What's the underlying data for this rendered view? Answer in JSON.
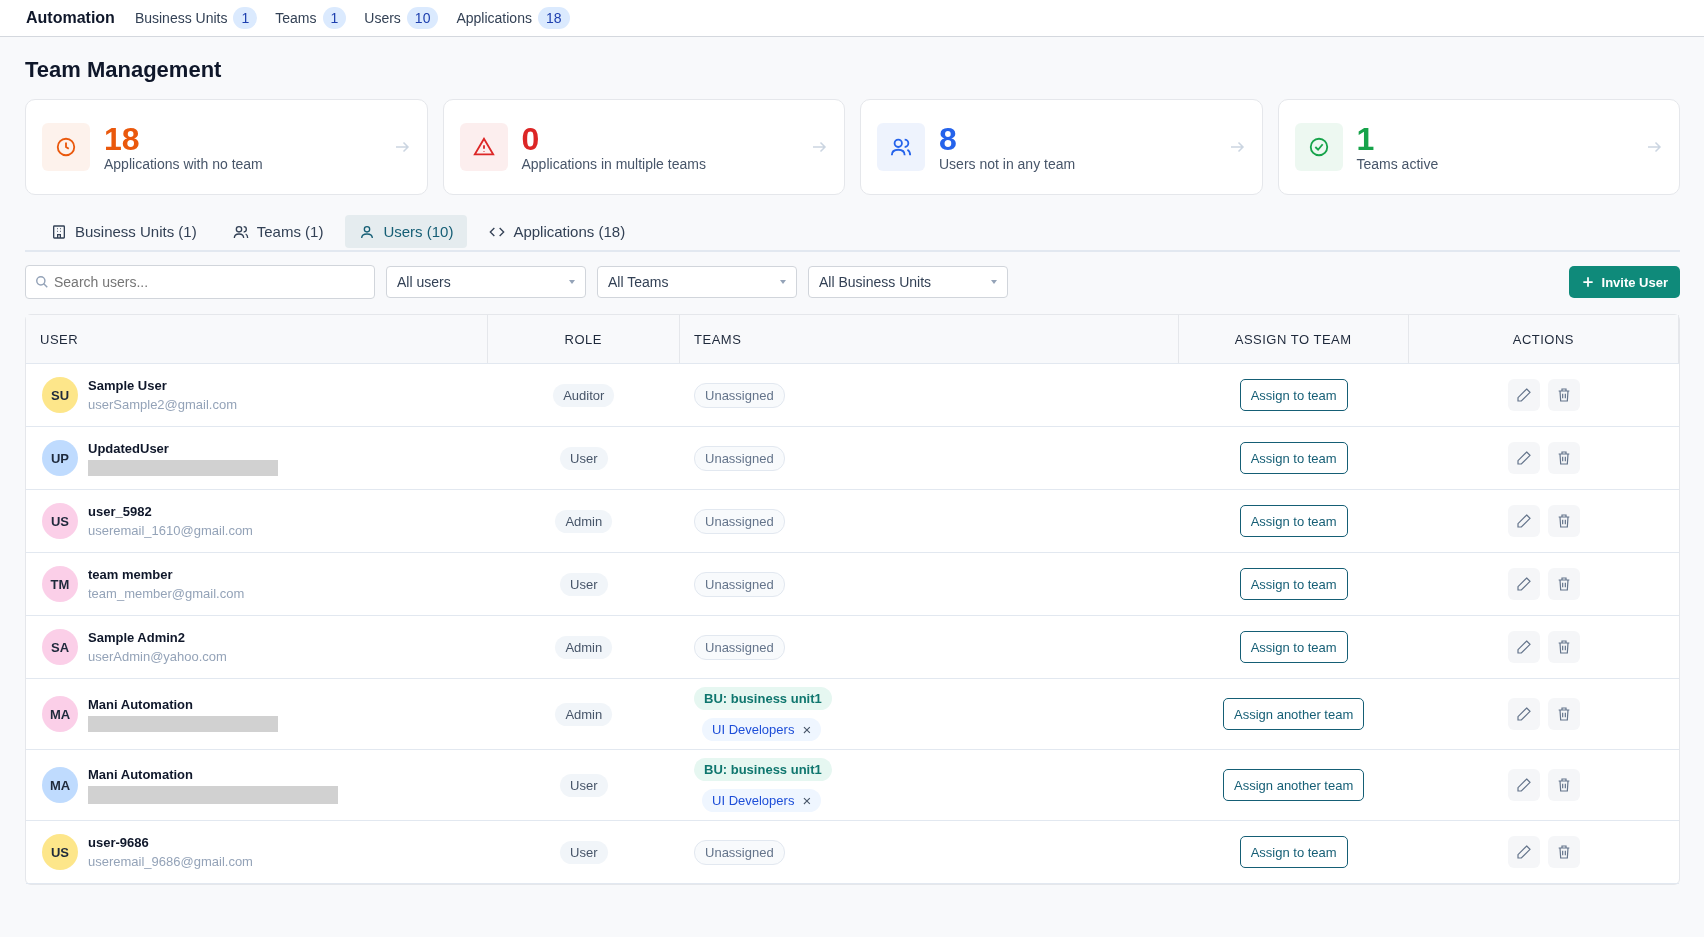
{
  "top_nav": {
    "brand": "Automation",
    "items": [
      {
        "label": "Business Units",
        "count": "1"
      },
      {
        "label": "Teams",
        "count": "1"
      },
      {
        "label": "Users",
        "count": "10"
      },
      {
        "label": "Applications",
        "count": "18"
      }
    ]
  },
  "page_title": "Team Management",
  "stats": [
    {
      "kind": "clock",
      "value": "18",
      "label": "Applications with no team",
      "color": "#ea580c"
    },
    {
      "kind": "warning",
      "value": "0",
      "label": "Applications in multiple teams",
      "color": "#dc2626"
    },
    {
      "kind": "users",
      "value": "8",
      "label": "Users not in any team",
      "color": "#2563eb"
    },
    {
      "kind": "check",
      "value": "1",
      "label": "Teams active",
      "color": "#16a34a"
    }
  ],
  "tabs": [
    {
      "kind": "building",
      "label": "Business Units (1)",
      "selected": false
    },
    {
      "kind": "users",
      "label": "Teams (1)",
      "selected": false
    },
    {
      "kind": "user",
      "label": "Users (10)",
      "selected": true
    },
    {
      "kind": "code",
      "label": "Applications (18)",
      "selected": false
    }
  ],
  "filters": {
    "search": {
      "placeholder": "Search users..."
    },
    "selects": [
      "All users",
      "All Teams",
      "All Business Units"
    ],
    "invite_button": "Invite User"
  },
  "table": {
    "columns": [
      "USER",
      "ROLE",
      "TEAMS",
      "ASSIGN TO TEAM",
      "ACTIONS"
    ],
    "rows": [
      {
        "initials": "SU",
        "color": "#fde68a",
        "name": "Sample User",
        "email": "userSample2@gmail.com",
        "role": "Auditor",
        "teams": [
          {
            "kind": "unassigned",
            "label": "Unassigned"
          }
        ],
        "assign": "Assign to team"
      },
      {
        "initials": "UP",
        "color": "#bfdbfe",
        "name": "UpdatedUser",
        "email_redacted": true,
        "role": "User",
        "teams": [
          {
            "kind": "unassigned",
            "label": "Unassigned"
          }
        ],
        "assign": "Assign to team"
      },
      {
        "initials": "US",
        "color": "#fbcfe8",
        "name": "user_5982",
        "email": "useremail_1610@gmail.com",
        "role": "Admin",
        "teams": [
          {
            "kind": "unassigned",
            "label": "Unassigned"
          }
        ],
        "assign": "Assign to team"
      },
      {
        "initials": "TM",
        "color": "#fbcfe8",
        "name": "team member",
        "email": "team_member@gmail.com",
        "role": "User",
        "teams": [
          {
            "kind": "unassigned",
            "label": "Unassigned"
          }
        ],
        "assign": "Assign to team"
      },
      {
        "initials": "SA",
        "color": "#fbcfe8",
        "name": "Sample Admin2",
        "email": "userAdmin@yahoo.com",
        "role": "Admin",
        "teams": [
          {
            "kind": "unassigned",
            "label": "Unassigned"
          }
        ],
        "assign": "Assign to team"
      },
      {
        "initials": "MA",
        "color": "#fbcfe8",
        "name": "Mani Automation",
        "email_redacted": true,
        "role": "Admin",
        "teams": [
          {
            "kind": "business_unit",
            "label": "BU: business unit1"
          },
          {
            "kind": "team",
            "label": "UI Developers",
            "remove": "×"
          }
        ],
        "assign": "Assign another team"
      },
      {
        "initials": "MA",
        "color": "#bfdbfe",
        "name": "Mani Automation",
        "email_redacted": true,
        "role": "User",
        "teams": [
          {
            "kind": "business_unit",
            "label": "BU: business unit1"
          },
          {
            "kind": "team",
            "label": "UI Developers",
            "remove": "×"
          }
        ],
        "assign": "Assign another team"
      },
      {
        "initials": "US",
        "color": "#fde68a",
        "name": "user-9686",
        "email": "useremail_9686@gmail.com",
        "role": "User",
        "teams": [
          {
            "kind": "unassigned",
            "label": "Unassigned"
          }
        ],
        "assign": "Assign to team"
      }
    ]
  }
}
